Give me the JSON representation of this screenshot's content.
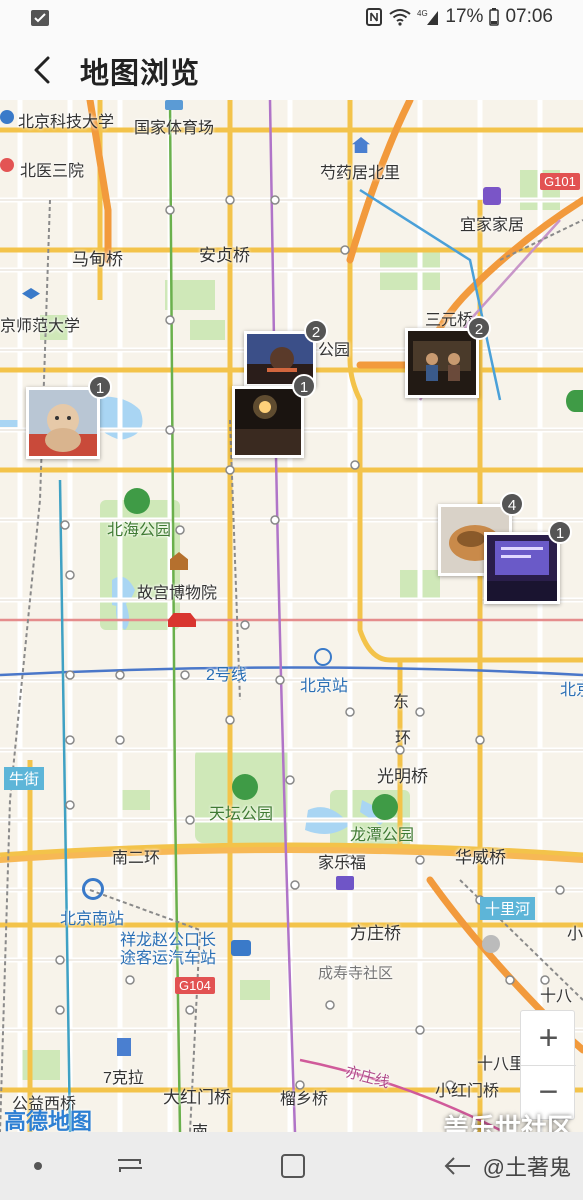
{
  "status_bar": {
    "battery": "17%",
    "time": "07:06",
    "network": "4G"
  },
  "header": {
    "title": "地图浏览"
  },
  "map": {
    "labels": [
      {
        "text": "北京科技大学"
      },
      {
        "text": "国家体育场"
      },
      {
        "text": "北医三院"
      },
      {
        "text": "芍药居北里"
      },
      {
        "text": "宜家家居"
      },
      {
        "text": "马甸桥"
      },
      {
        "text": "安贞桥"
      },
      {
        "text": "京师范大学"
      },
      {
        "text": "三元桥"
      },
      {
        "text": "公园"
      },
      {
        "text": "北海公园"
      },
      {
        "text": "故宫博物院"
      },
      {
        "text": "2号线"
      },
      {
        "text": "北京站"
      },
      {
        "text": "北京"
      },
      {
        "text": "东"
      },
      {
        "text": "环"
      },
      {
        "text": "光明桥"
      },
      {
        "text": "天坛公园"
      },
      {
        "text": "龙潭公园"
      },
      {
        "text": "南二环"
      },
      {
        "text": "家乐福"
      },
      {
        "text": "华威桥"
      },
      {
        "text": "北京南站"
      },
      {
        "text": "十里河"
      },
      {
        "text": "方庄桥"
      },
      {
        "text": "祥龙赵公口长途客运汽车站"
      },
      {
        "text": "成寿寺社区"
      },
      {
        "text": "十八"
      },
      {
        "text": "7克拉"
      },
      {
        "text": "十八里店南桥"
      },
      {
        "text": "公益西桥"
      },
      {
        "text": "大红门桥"
      },
      {
        "text": "榴乡桥"
      },
      {
        "text": "亦庄线"
      },
      {
        "text": "小红门桥"
      },
      {
        "text": "牛街"
      },
      {
        "text": "小"
      },
      {
        "text": "南"
      }
    ],
    "road_tags": [
      {
        "text": "G101"
      },
      {
        "text": "G104"
      }
    ],
    "photo_pins": [
      {
        "count": "1",
        "name": "doll"
      },
      {
        "count": "2",
        "name": "evening-park"
      },
      {
        "count": "1",
        "name": "night-street"
      },
      {
        "count": "2",
        "name": "band-stage"
      },
      {
        "count": "4",
        "name": "food"
      },
      {
        "count": "1",
        "name": "presentation"
      }
    ],
    "zoom_in": "+",
    "zoom_out": "−",
    "logo": "高德地图",
    "watermark": "盖乐世社区"
  },
  "nav_bar": {
    "credit": "@土著鬼"
  },
  "colors": {
    "ring_road": "#f3c34a",
    "highway": "#f29a3c",
    "park_green": "#c8e6b0",
    "water": "#a8d4f2",
    "badge": "#555555"
  }
}
